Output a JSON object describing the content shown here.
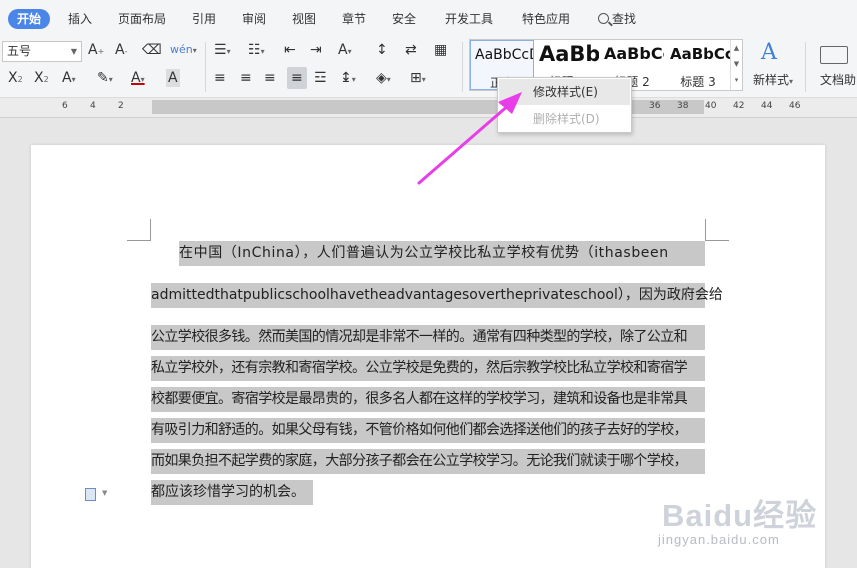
{
  "menubar": {
    "tabs": [
      "开始",
      "插入",
      "页面布局",
      "引用",
      "审阅",
      "视图",
      "章节",
      "安全",
      "开发工具",
      "特色应用",
      "查找"
    ]
  },
  "toolbar": {
    "font_size": "五号",
    "new_style_label": "新样式",
    "doc_helper_label": "文档助",
    "styles": [
      {
        "sample": "AaBbCcD",
        "name": "正文"
      },
      {
        "sample": "AaBb",
        "name": "标题 1"
      },
      {
        "sample": "AaBbCc",
        "name": "标题 2"
      },
      {
        "sample": "AaBbCc",
        "name": "标题 3"
      }
    ]
  },
  "ruler": {
    "left_ticks": [
      "6",
      "4",
      "2"
    ],
    "right_ticks": [
      "36",
      "38",
      "40",
      "42",
      "44",
      "46"
    ]
  },
  "context_menu": {
    "modify_style": "修改样式(E)",
    "delete_style": "删除样式(D)"
  },
  "document": {
    "lines": [
      "在中国（InChina），人们普遍认为公立学校比私立学校有优势（ithasbeen",
      "admittedthatpublicschoolhavetheadvantagesovertheprivateschool），因为政府会给",
      "公立学校很多钱。然而美国的情况却是非常不一样的。通常有四种类型的学校，除了公立和",
      "私立学校外，还有宗教和寄宿学校。公立学校是免费的，然后宗教学校比私立学校和寄宿学",
      "校都要便宜。寄宿学校是最昂贵的，很多名人都在这样的学校学习，建筑和设备也是非常具",
      "有吸引力和舒适的。如果父母有钱，不管价格如何他们都会选择送他们的孩子去好的学校，",
      "而如果负担不起学费的家庭，大部分孩子都会在公立学校学习。无论我们就读于哪个学校，",
      "都应该珍惜学习的机会。"
    ]
  },
  "watermark": {
    "logo": "Baidu经验",
    "url": "jingyan.baidu.com"
  },
  "colors": {
    "active_tab": "#4a86e8",
    "selection": "#c8c8c8",
    "annotation_arrow": "#e83ee8"
  }
}
